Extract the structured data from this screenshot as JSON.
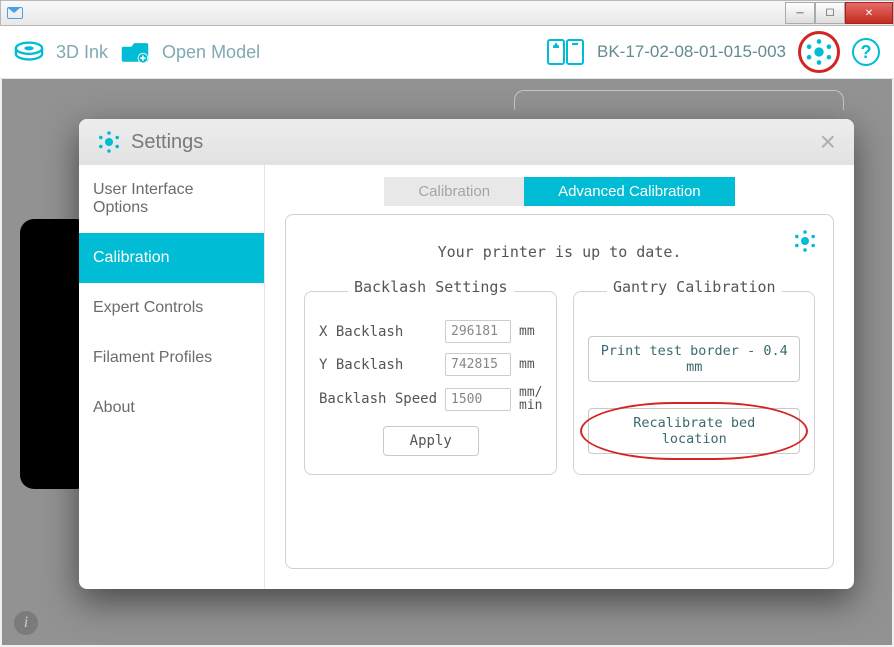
{
  "header": {
    "ink_label": "3D Ink",
    "open_label": "Open Model",
    "device_id": "BK-17-02-08-01-015-003"
  },
  "modal": {
    "title": "Settings",
    "sidebar": {
      "items": [
        {
          "label": "User Interface Options"
        },
        {
          "label": "Calibration"
        },
        {
          "label": "Expert Controls"
        },
        {
          "label": "Filament Profiles"
        },
        {
          "label": "About"
        }
      ]
    },
    "tabs": {
      "calibration": "Calibration",
      "advanced": "Advanced Calibration"
    },
    "status": "Your printer is up to date.",
    "backlash": {
      "title": "Backlash Settings",
      "x_label": "X Backlash",
      "x_value": "296181",
      "y_label": "Y Backlash",
      "y_value": "742815",
      "speed_label": "Backlash Speed",
      "speed_value": "1500",
      "mm_unit": "mm",
      "speed_unit1": "mm/",
      "speed_unit2": "min",
      "apply": "Apply"
    },
    "gantry": {
      "title": "Gantry Calibration",
      "print_border": "Print test border - 0.4 mm",
      "recalibrate": "Recalibrate bed location"
    }
  }
}
